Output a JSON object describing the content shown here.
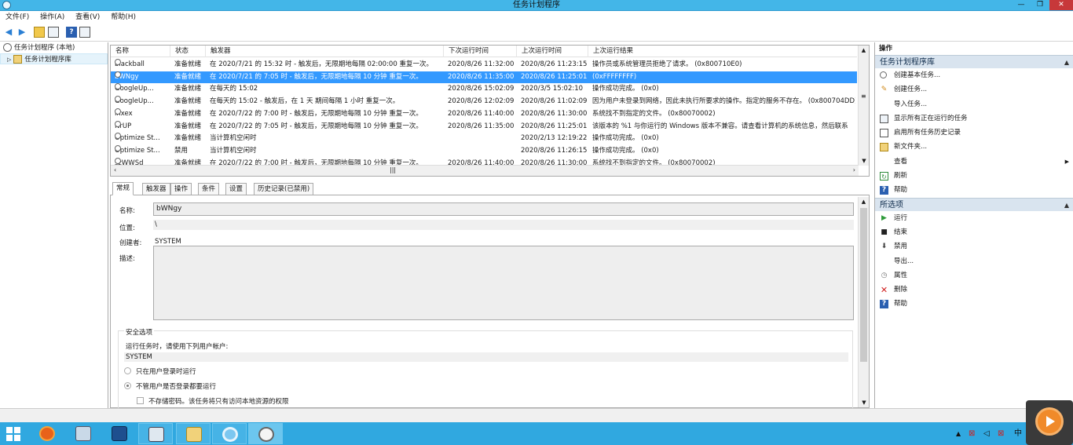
{
  "window": {
    "title": "任务计划程序",
    "minimize": "—",
    "restore": "❐",
    "close": "✕"
  },
  "menu": [
    "文件(F)",
    "操作(A)",
    "查看(V)",
    "帮助(H)"
  ],
  "tree": {
    "root": "任务计划程序 (本地)",
    "library": "任务计划程序库"
  },
  "grid": {
    "columns": [
      "名称",
      "状态",
      "触发器",
      "下次运行时间",
      "上次运行时间",
      "上次运行结果"
    ],
    "rows": [
      {
        "name": "blackball",
        "status": "准备就绪",
        "trigger": "在 2020/7/21 的 15:32 时 - 触发后，无限期地每隔 02:00:00 重复一次。",
        "next": "2020/8/26 11:32:00",
        "last": "2020/8/26 11:23:15",
        "result": "操作员或系统管理员拒绝了请求。 (0x800710E0)"
      },
      {
        "name": "bWNgy",
        "status": "准备就绪",
        "trigger": "在 2020/7/21 的 7:05 时 - 触发后，无限期地每隔 10 分钟 重复一次。",
        "next": "2020/8/26 11:35:00",
        "last": "2020/8/26 11:25:01",
        "result": "(0xFFFFFFFF)"
      },
      {
        "name": "GoogleUp...",
        "status": "准备就绪",
        "trigger": "在每天的 15:02",
        "next": "2020/8/26 15:02:09",
        "last": "2020/3/5 15:02:10",
        "result": "操作成功完成。 (0x0)"
      },
      {
        "name": "GoogleUp...",
        "status": "准备就绪",
        "trigger": "在每天的 15:02 - 触发后，在 1 天 期间每隔 1 小时 重复一次。",
        "next": "2020/8/26 12:02:09",
        "last": "2020/8/26 11:02:09",
        "result": "因为用户未登录到网络，因此未执行所要求的操作。指定的服务不存在。 (0x800704DD)"
      },
      {
        "name": "inxex",
        "status": "准备就绪",
        "trigger": "在 2020/7/22 的 7:00 时 - 触发后，无限期地每隔 10 分钟 重复一次。",
        "next": "2020/8/26 11:40:00",
        "last": "2020/8/26 11:30:00",
        "result": "系统找不到指定的文件。 (0x80070002)"
      },
      {
        "name": "NrUP",
        "status": "准备就绪",
        "trigger": "在 2020/7/22 的 7:05 时 - 触发后，无限期地每隔 10 分钟 重复一次。",
        "next": "2020/8/26 11:35:00",
        "last": "2020/8/26 11:25:01",
        "result": "该版本的 %1 与你运行的 Windows 版本不兼容。请查看计算机的系统信息，然后联系"
      },
      {
        "name": "Optimize St...",
        "status": "准备就绪",
        "trigger": "当计算机空闲时",
        "next": "",
        "last": "2020/2/13 12:19:22",
        "result": "操作成功完成。 (0x0)"
      },
      {
        "name": "Optimize St...",
        "status": "禁用",
        "trigger": "当计算机空闲时",
        "next": "",
        "last": "2020/8/26 11:26:15",
        "result": "操作成功完成。 (0x0)"
      },
      {
        "name": "szWWSd",
        "status": "准备就绪",
        "trigger": "在 2020/7/22 的 7:00 时 - 触发后，无限期地每隔 10 分钟 重复一次。",
        "next": "2020/8/26 11:40:00",
        "last": "2020/8/26 11:30:00",
        "result": "系统找不到指定的文件。 (0x80070002)"
      }
    ]
  },
  "tabs": [
    "常规",
    "触发器",
    "操作",
    "条件",
    "设置",
    "历史记录(已禁用)"
  ],
  "general": {
    "name_label": "名称:",
    "name_value": "bWNgy",
    "location_label": "位置:",
    "location_value": "\\",
    "author_label": "创建者:",
    "author_value": "SYSTEM",
    "desc_label": "描述:",
    "desc_value": "",
    "security_title": "安全选项",
    "run_as_label": "运行任务时，请使用下列用户帐户:",
    "run_as_value": "SYSTEM",
    "opt_logged_on": "只在用户登录时运行",
    "opt_any": "不管用户是否登录都要运行",
    "opt_no_password": "不存储密码。该任务将只有访问本地资源的权限"
  },
  "actions": {
    "title": "操作",
    "section1": "任务计划程序库",
    "items1": [
      "创建基本任务...",
      "创建任务...",
      "导入任务...",
      "显示所有正在运行的任务",
      "启用所有任务历史记录",
      "新文件夹...",
      "查看",
      "刷新",
      "帮助"
    ],
    "section2": "所选项",
    "items2": [
      "运行",
      "结束",
      "禁用",
      "导出...",
      "属性",
      "删除",
      "帮助"
    ]
  },
  "taskbar": {
    "ime": "中"
  }
}
